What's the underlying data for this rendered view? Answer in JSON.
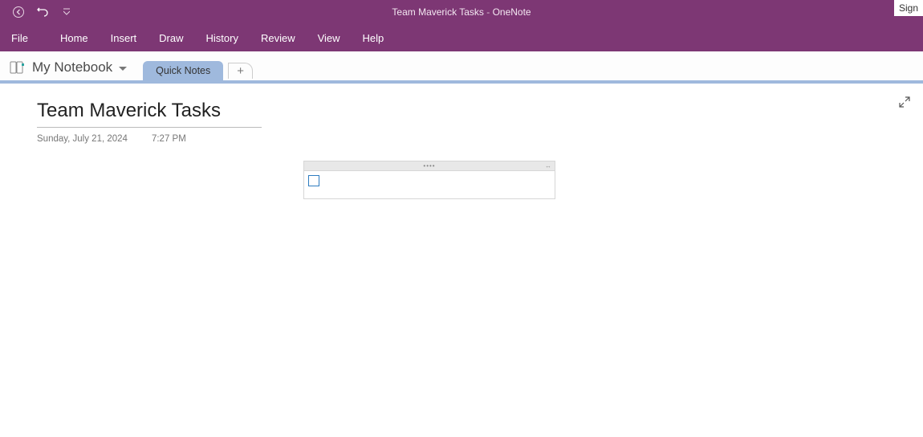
{
  "window": {
    "document_title": "Team Maverick Tasks",
    "separator": "  -  ",
    "app_name": "OneNote",
    "sign_in": "Sign"
  },
  "menu": {
    "file": "File",
    "items": [
      "Home",
      "Insert",
      "Draw",
      "History",
      "Review",
      "View",
      "Help"
    ]
  },
  "notebook": {
    "label": "My Notebook",
    "section_active": "Quick Notes"
  },
  "page": {
    "title": "Team Maverick Tasks",
    "date": "Sunday, July 21, 2024",
    "time": "7:27 PM"
  }
}
